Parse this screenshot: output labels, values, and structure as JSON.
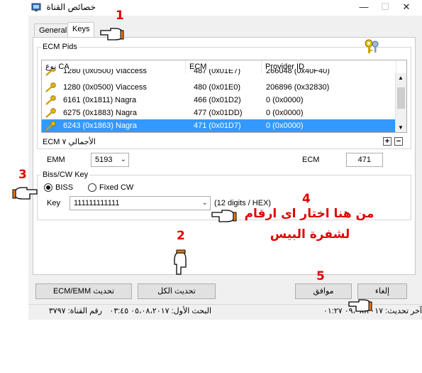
{
  "window": {
    "title": "خصائص القناة",
    "minimize": "—",
    "maximize": "☐",
    "close": "✕"
  },
  "tabs": [
    {
      "label": "General"
    },
    {
      "label": "Keys"
    }
  ],
  "ecm_pids": {
    "group_title": "ECM Pids",
    "columns": [
      "نوع CA",
      "ECM",
      "Provider ID"
    ],
    "rows": [
      {
        "ca": "1280  (0x0500) Viaccess",
        "ecm": "487  (0x01E7)",
        "provider": "266048  (0x40F40)"
      },
      {
        "ca": "1280  (0x0500) Viaccess",
        "ecm": "480  (0x01E0)",
        "provider": "206896  (0x32830)"
      },
      {
        "ca": "6161  (0x1811) Nagra",
        "ecm": "466  (0x01D2)",
        "provider": "0  (0x0000)"
      },
      {
        "ca": "6275  (0x1883) Nagra",
        "ecm": "477  (0x01DD)",
        "provider": "0  (0x0000)"
      },
      {
        "ca": "6243  (0x1863) Nagra",
        "ecm": "471  (0x01D7)",
        "provider": "0  (0x0000)"
      }
    ],
    "total_label": "ECM الأجمالي ٧",
    "add": "+",
    "remove": "−"
  },
  "emm": {
    "label": "EMM",
    "value": "5193"
  },
  "ecm_field": {
    "label": "ECM",
    "value": "471"
  },
  "biss": {
    "group_title": "Biss/CW Key",
    "radio_biss": "BISS",
    "radio_fixed": "Fixed CW",
    "key_label": "Key",
    "key_value": "111111111111",
    "hint": "(12 digits / HEX)"
  },
  "buttons": {
    "ecm_emm": "ECM/EMM تحديث",
    "update_all": "تحديث الكل",
    "ok": "موافق",
    "cancel": "إلغاء"
  },
  "status": {
    "last_update": "آخر تحديث: ٠٩،٠٨،٢٠١٧  ٠١:٢٧",
    "first_search": "البحث الأول: ٠٥،٠٨،٢٠١٧  ٠٣:٤٥",
    "channel_no": "رقم القناة: ٣٧٩٧"
  },
  "annotations": {
    "n1": "1",
    "n2": "2",
    "n3": "3",
    "n4": "4",
    "n5": "5",
    "arabic_line1": "من هنا اختار اى ارقام",
    "arabic_line2": "لشفرة البيس"
  },
  "colors": {
    "selection": "#3399ff",
    "annotation_red": "#e00000"
  }
}
